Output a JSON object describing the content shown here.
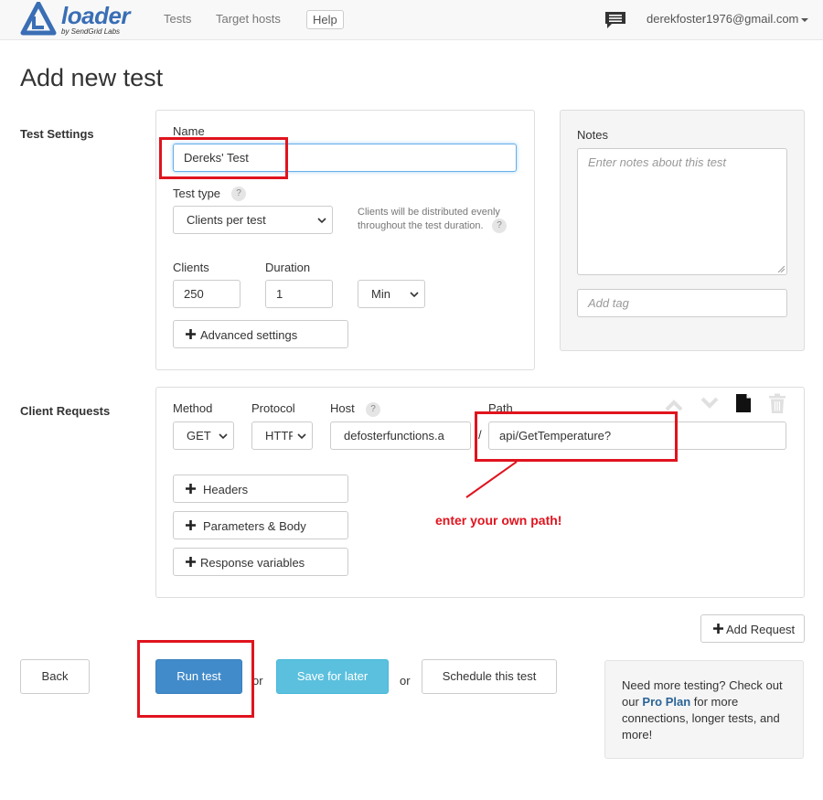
{
  "brand": {
    "name": "loader",
    "sub": "by SendGrid Labs",
    "color": "#3a6eb5"
  },
  "nav": {
    "tests": "Tests",
    "target_hosts": "Target hosts",
    "help": "Help",
    "user": "derekfoster1976@gmail.com"
  },
  "page": {
    "title": "Add new test"
  },
  "test_settings": {
    "section_label": "Test Settings",
    "name_label": "Name",
    "name_value": "Dereks' Test",
    "test_type_label": "Test type",
    "test_type_value": "Clients per test",
    "distribution_note_line1": "Clients will be distributed evenly",
    "distribution_note_line2": "throughout the test duration.",
    "clients_label": "Clients",
    "clients_value": "250",
    "duration_label": "Duration",
    "duration_value": "1",
    "duration_unit": "Min",
    "advanced_label": "Advanced settings",
    "help_glyph": "?"
  },
  "notes": {
    "label": "Notes",
    "placeholder": "Enter notes about this test",
    "tag_placeholder": "Add tag"
  },
  "client_requests": {
    "section_label": "Client Requests",
    "method_label": "Method",
    "method_value": "GET",
    "protocol_label": "Protocol",
    "protocol_value": "HTTP",
    "host_label": "Host",
    "host_value": "defosterfunctions.azurewebsites.net",
    "slash": "/",
    "path_label": "Path",
    "path_value": "api/GetTemperature?",
    "headers_label": "Headers",
    "params_label": "Parameters & Body",
    "response_vars_label": "Response variables",
    "add_request_label": "Add Request"
  },
  "annotation": {
    "text": "enter your own path!",
    "color": "#e0141e"
  },
  "actions": {
    "back": "Back",
    "run": "Run test",
    "or1": "or",
    "save": "Save for later",
    "or2": "or",
    "schedule": "Schedule this test"
  },
  "promo": {
    "line1": "Need more testing? Check out our ",
    "link": "Pro Plan",
    "line2": " for more connections, longer tests, and more!"
  }
}
